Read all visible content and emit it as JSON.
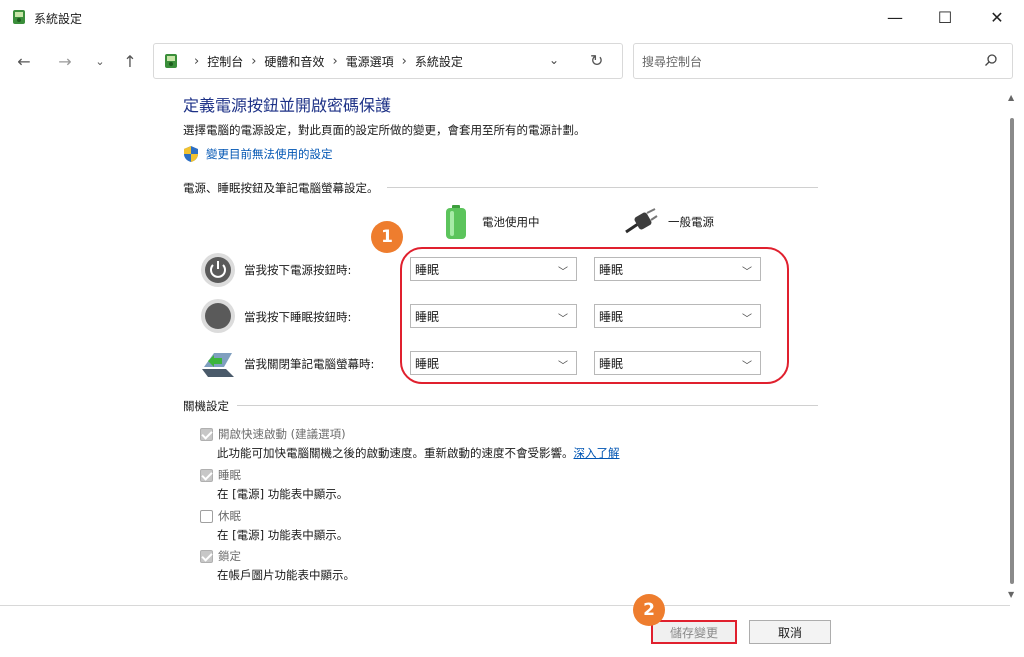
{
  "window": {
    "title": "系統設定",
    "minimize_glyph": "—",
    "maximize_glyph": "☐",
    "close_glyph": "✕"
  },
  "nav": {
    "back_glyph": "←",
    "forward_glyph": "→",
    "recent_glyph": "⌄",
    "up_glyph": "↑",
    "breadcrumbs": [
      "控制台",
      "硬體和音效",
      "電源選項",
      "系統設定"
    ],
    "separator": "›",
    "dropdown_glyph": "⌄",
    "refresh_glyph": "↻",
    "search_placeholder": "搜尋控制台"
  },
  "page": {
    "heading": "定義電源按鈕並開啟密碼保護",
    "subtitle": "選擇電腦的電源設定，對此頁面的設定所做的變更，會套用至所有的電源計劃。",
    "change_link": "變更目前無法使用的設定"
  },
  "buttons_section": {
    "title": "電源、睡眠按鈕及筆記電腦螢幕設定。",
    "col_battery": "電池使用中",
    "col_plugged": "一般電源",
    "rows": [
      {
        "label": "當我按下電源按鈕時:",
        "battery": "睡眠",
        "plugged": "睡眠",
        "icon": "power-button-icon"
      },
      {
        "label": "當我按下睡眠按鈕時:",
        "battery": "睡眠",
        "plugged": "睡眠",
        "icon": "sleep-button-icon"
      },
      {
        "label": "當我關閉筆記電腦螢幕時:",
        "battery": "睡眠",
        "plugged": "睡眠",
        "icon": "laptop-lid-icon"
      }
    ],
    "chevron": "﹀"
  },
  "shutdown_section": {
    "title": "關機設定",
    "items": [
      {
        "label": "開啟快速啟動 (建議選項)",
        "desc": "此功能可加快電腦關機之後的啟動速度。重新啟動的速度不會受影響。",
        "link": "深入了解",
        "checked": true
      },
      {
        "label": "睡眠",
        "desc": "在 [電源] 功能表中顯示。",
        "checked": true
      },
      {
        "label": "休眠",
        "desc": "在 [電源] 功能表中顯示。",
        "checked": false
      },
      {
        "label": "鎖定",
        "desc": "在帳戶圖片功能表中顯示。",
        "checked": true
      }
    ]
  },
  "annotations": {
    "badge1": "1",
    "badge2": "2",
    "accent": "#ee7d2e",
    "highlight": "#e0202e"
  },
  "footer": {
    "save": "儲存變更",
    "cancel": "取消"
  },
  "scroll": {
    "up_glyph": "▲",
    "down_glyph": "▼"
  }
}
